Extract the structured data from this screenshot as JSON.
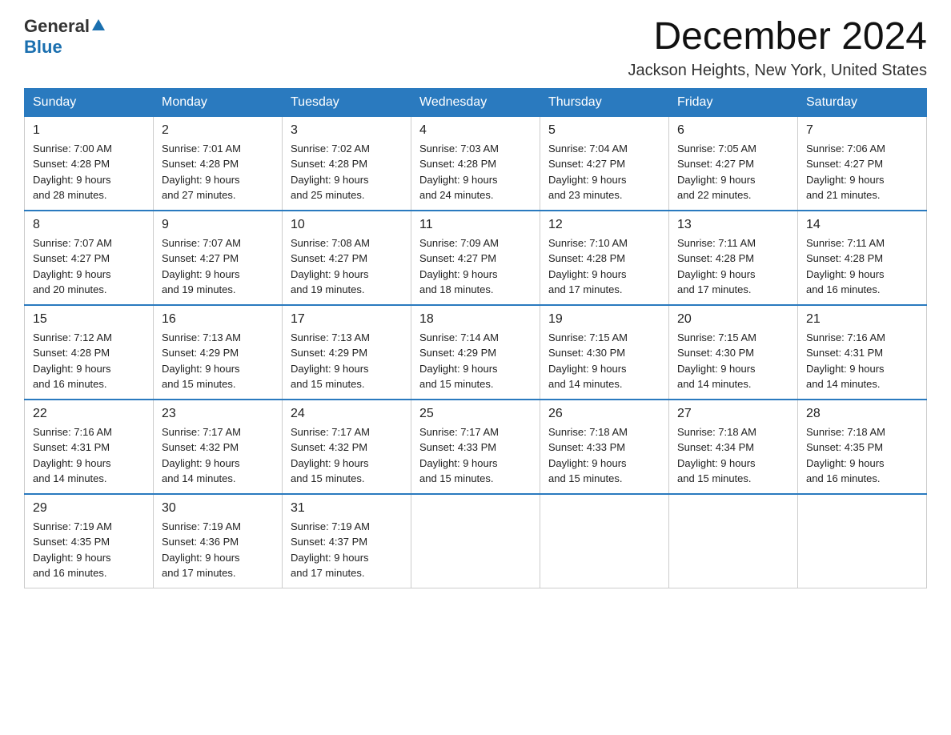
{
  "header": {
    "logo_general": "General",
    "logo_blue": "Blue",
    "month": "December 2024",
    "location": "Jackson Heights, New York, United States"
  },
  "weekdays": [
    "Sunday",
    "Monday",
    "Tuesday",
    "Wednesday",
    "Thursday",
    "Friday",
    "Saturday"
  ],
  "weeks": [
    [
      {
        "day": "1",
        "sunrise": "7:00 AM",
        "sunset": "4:28 PM",
        "daylight": "9 hours and 28 minutes."
      },
      {
        "day": "2",
        "sunrise": "7:01 AM",
        "sunset": "4:28 PM",
        "daylight": "9 hours and 27 minutes."
      },
      {
        "day": "3",
        "sunrise": "7:02 AM",
        "sunset": "4:28 PM",
        "daylight": "9 hours and 25 minutes."
      },
      {
        "day": "4",
        "sunrise": "7:03 AM",
        "sunset": "4:28 PM",
        "daylight": "9 hours and 24 minutes."
      },
      {
        "day": "5",
        "sunrise": "7:04 AM",
        "sunset": "4:27 PM",
        "daylight": "9 hours and 23 minutes."
      },
      {
        "day": "6",
        "sunrise": "7:05 AM",
        "sunset": "4:27 PM",
        "daylight": "9 hours and 22 minutes."
      },
      {
        "day": "7",
        "sunrise": "7:06 AM",
        "sunset": "4:27 PM",
        "daylight": "9 hours and 21 minutes."
      }
    ],
    [
      {
        "day": "8",
        "sunrise": "7:07 AM",
        "sunset": "4:27 PM",
        "daylight": "9 hours and 20 minutes."
      },
      {
        "day": "9",
        "sunrise": "7:07 AM",
        "sunset": "4:27 PM",
        "daylight": "9 hours and 19 minutes."
      },
      {
        "day": "10",
        "sunrise": "7:08 AM",
        "sunset": "4:27 PM",
        "daylight": "9 hours and 19 minutes."
      },
      {
        "day": "11",
        "sunrise": "7:09 AM",
        "sunset": "4:27 PM",
        "daylight": "9 hours and 18 minutes."
      },
      {
        "day": "12",
        "sunrise": "7:10 AM",
        "sunset": "4:28 PM",
        "daylight": "9 hours and 17 minutes."
      },
      {
        "day": "13",
        "sunrise": "7:11 AM",
        "sunset": "4:28 PM",
        "daylight": "9 hours and 17 minutes."
      },
      {
        "day": "14",
        "sunrise": "7:11 AM",
        "sunset": "4:28 PM",
        "daylight": "9 hours and 16 minutes."
      }
    ],
    [
      {
        "day": "15",
        "sunrise": "7:12 AM",
        "sunset": "4:28 PM",
        "daylight": "9 hours and 16 minutes."
      },
      {
        "day": "16",
        "sunrise": "7:13 AM",
        "sunset": "4:29 PM",
        "daylight": "9 hours and 15 minutes."
      },
      {
        "day": "17",
        "sunrise": "7:13 AM",
        "sunset": "4:29 PM",
        "daylight": "9 hours and 15 minutes."
      },
      {
        "day": "18",
        "sunrise": "7:14 AM",
        "sunset": "4:29 PM",
        "daylight": "9 hours and 15 minutes."
      },
      {
        "day": "19",
        "sunrise": "7:15 AM",
        "sunset": "4:30 PM",
        "daylight": "9 hours and 14 minutes."
      },
      {
        "day": "20",
        "sunrise": "7:15 AM",
        "sunset": "4:30 PM",
        "daylight": "9 hours and 14 minutes."
      },
      {
        "day": "21",
        "sunrise": "7:16 AM",
        "sunset": "4:31 PM",
        "daylight": "9 hours and 14 minutes."
      }
    ],
    [
      {
        "day": "22",
        "sunrise": "7:16 AM",
        "sunset": "4:31 PM",
        "daylight": "9 hours and 14 minutes."
      },
      {
        "day": "23",
        "sunrise": "7:17 AM",
        "sunset": "4:32 PM",
        "daylight": "9 hours and 14 minutes."
      },
      {
        "day": "24",
        "sunrise": "7:17 AM",
        "sunset": "4:32 PM",
        "daylight": "9 hours and 15 minutes."
      },
      {
        "day": "25",
        "sunrise": "7:17 AM",
        "sunset": "4:33 PM",
        "daylight": "9 hours and 15 minutes."
      },
      {
        "day": "26",
        "sunrise": "7:18 AM",
        "sunset": "4:33 PM",
        "daylight": "9 hours and 15 minutes."
      },
      {
        "day": "27",
        "sunrise": "7:18 AM",
        "sunset": "4:34 PM",
        "daylight": "9 hours and 15 minutes."
      },
      {
        "day": "28",
        "sunrise": "7:18 AM",
        "sunset": "4:35 PM",
        "daylight": "9 hours and 16 minutes."
      }
    ],
    [
      {
        "day": "29",
        "sunrise": "7:19 AM",
        "sunset": "4:35 PM",
        "daylight": "9 hours and 16 minutes."
      },
      {
        "day": "30",
        "sunrise": "7:19 AM",
        "sunset": "4:36 PM",
        "daylight": "9 hours and 17 minutes."
      },
      {
        "day": "31",
        "sunrise": "7:19 AM",
        "sunset": "4:37 PM",
        "daylight": "9 hours and 17 minutes."
      },
      null,
      null,
      null,
      null
    ]
  ]
}
